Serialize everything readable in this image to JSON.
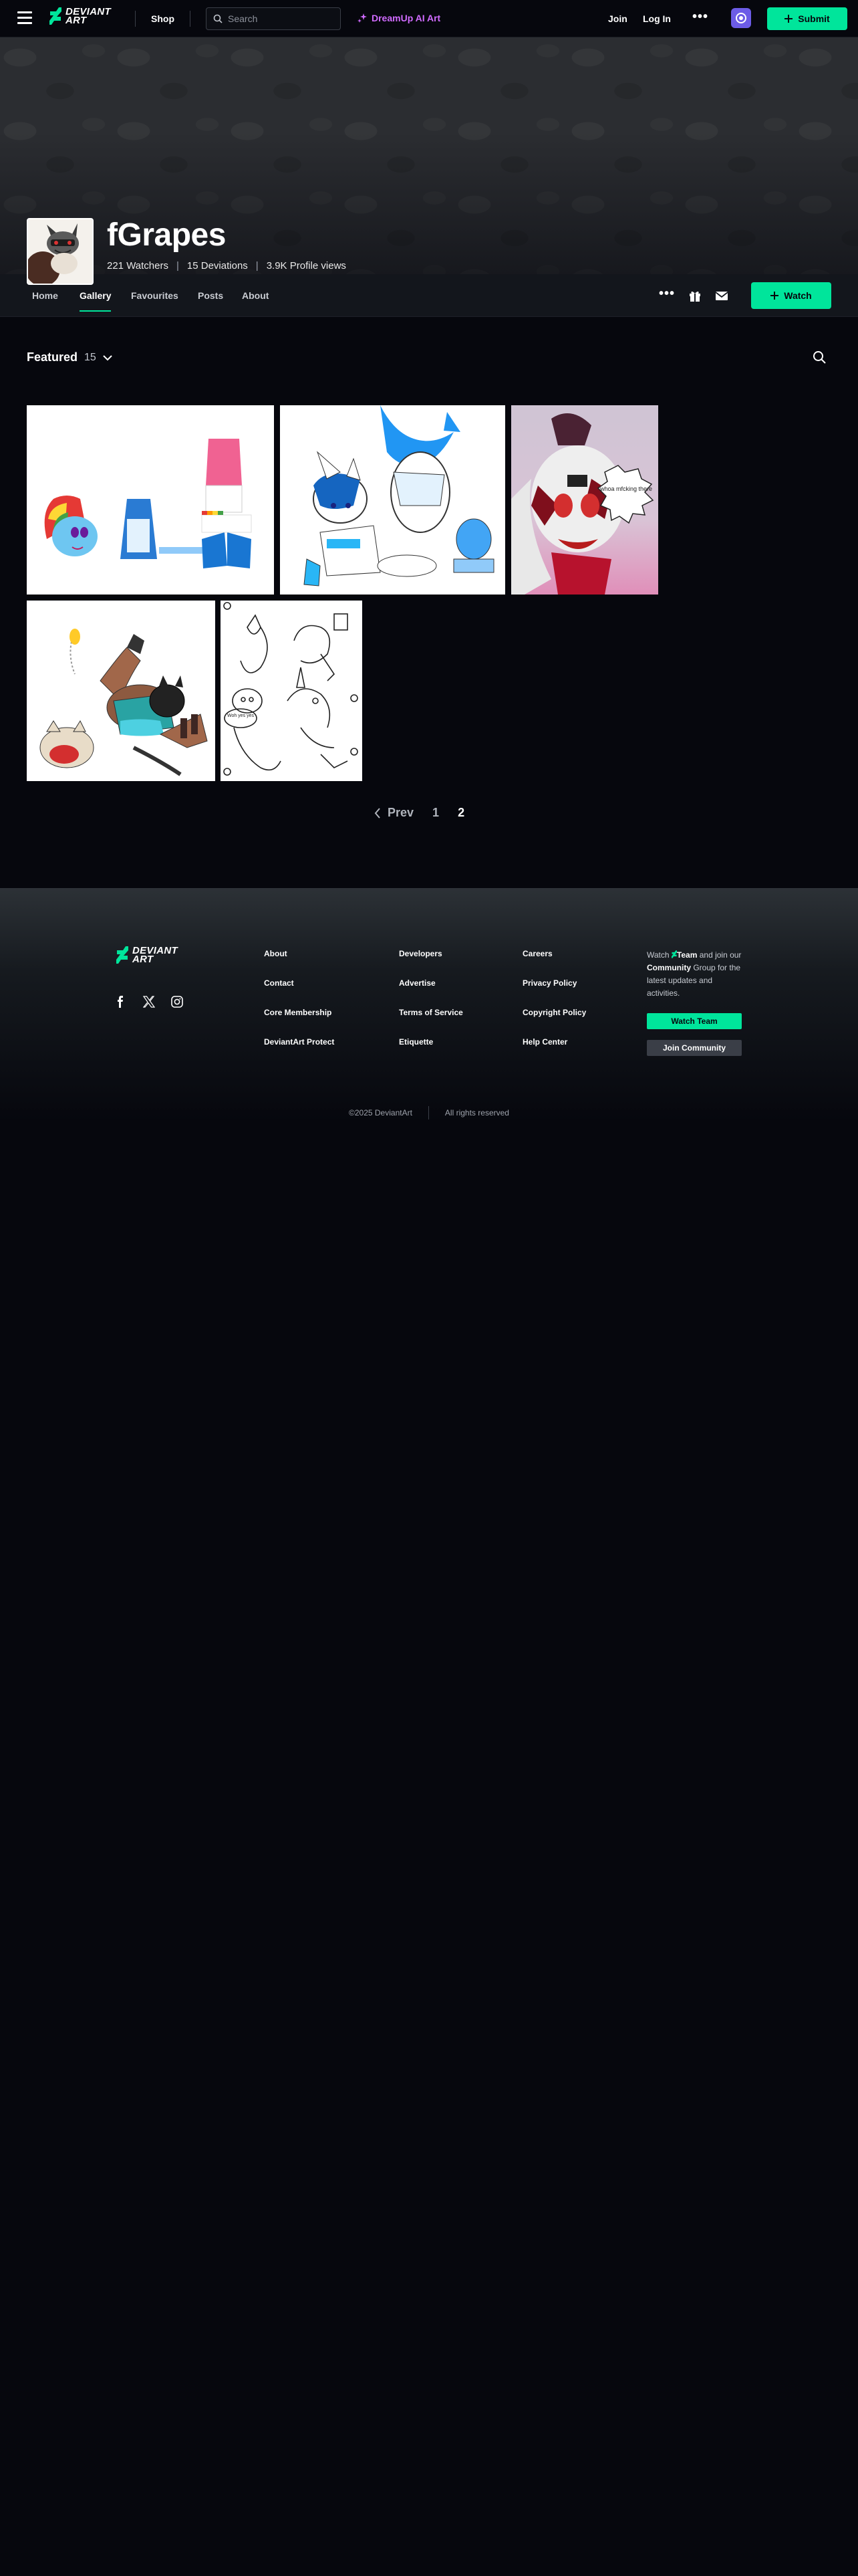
{
  "nav": {
    "logo_line1": "DEVIANT",
    "logo_line2": "ART",
    "shop": "Shop",
    "search_placeholder": "Search",
    "dreamup": "DreamUp AI Art",
    "join": "Join",
    "login": "Log In",
    "submit": "Submit"
  },
  "profile": {
    "name": "fGrapes",
    "watchers": "221 Watchers",
    "deviations": "15 Deviations",
    "profile_views": "3.9K Profile views"
  },
  "tabs": [
    "Home",
    "Gallery",
    "Favourites",
    "Posts",
    "About"
  ],
  "active_tab": "Gallery",
  "watch_button": "Watch",
  "gallery": {
    "folder": "Featured",
    "count": "15",
    "thumb_texts": {
      "speech_bubble": "whoa mfcking there",
      "monster_bubble": "Woh\nyes yes"
    }
  },
  "pagination": {
    "prev": "Prev",
    "pages": [
      "1",
      "2"
    ],
    "current": "2"
  },
  "footer": {
    "col1": [
      "About",
      "Contact",
      "Core Membership",
      "DeviantArt Protect"
    ],
    "col2": [
      "Developers",
      "Advertise",
      "Terms of Service",
      "Etiquette"
    ],
    "col3": [
      "Careers",
      "Privacy Policy",
      "Copyright Policy",
      "Help Center"
    ],
    "blurb_pre": "Watch",
    "blurb_team": "Team",
    "blurb_mid": "and join our",
    "blurb_community": "Community",
    "blurb_post": "Group for the latest updates and activities.",
    "watch_team": "Watch Team",
    "join_community": "Join Community",
    "copyright": "©2025 DeviantArt",
    "rights": "All rights reserved"
  },
  "colors": {
    "accent": "#00e59b",
    "dreamup": "#d06bff",
    "core_badge": "#6c5ce7",
    "background": "#06070d"
  }
}
